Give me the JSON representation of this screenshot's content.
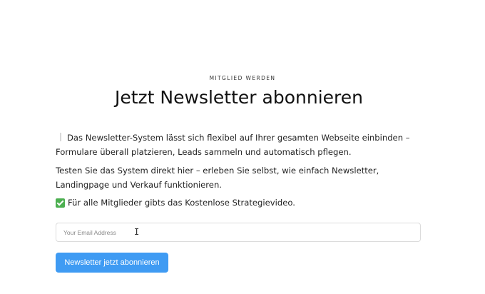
{
  "section": {
    "eyebrow": "MITGLIED WERDEN",
    "title": "Jetzt Newsletter abonnieren"
  },
  "content": {
    "paragraph_1": "Das Newsletter-System lässt sich flexibel auf Ihrer gesamten Webseite einbinden – Formulare überall platzieren, Leads sammeln und automatisch pflegen.",
    "paragraph_2": "Testen Sie das System direkt hier – erleben Sie selbst, wie einfach Newsletter, Landingpage und Verkauf funktionieren.",
    "paragraph_3": "Für alle Mitglieder gibts das Kostenlose Strategievideo."
  },
  "form": {
    "email_placeholder": "Your Email Address",
    "email_value": "",
    "submit_label": "Newsletter jetzt abonnieren"
  },
  "colors": {
    "button": "#3f9bf3",
    "check": "#4caf50"
  },
  "icons": {
    "check": "check-mark-icon",
    "cursor": "text-cursor-icon"
  }
}
